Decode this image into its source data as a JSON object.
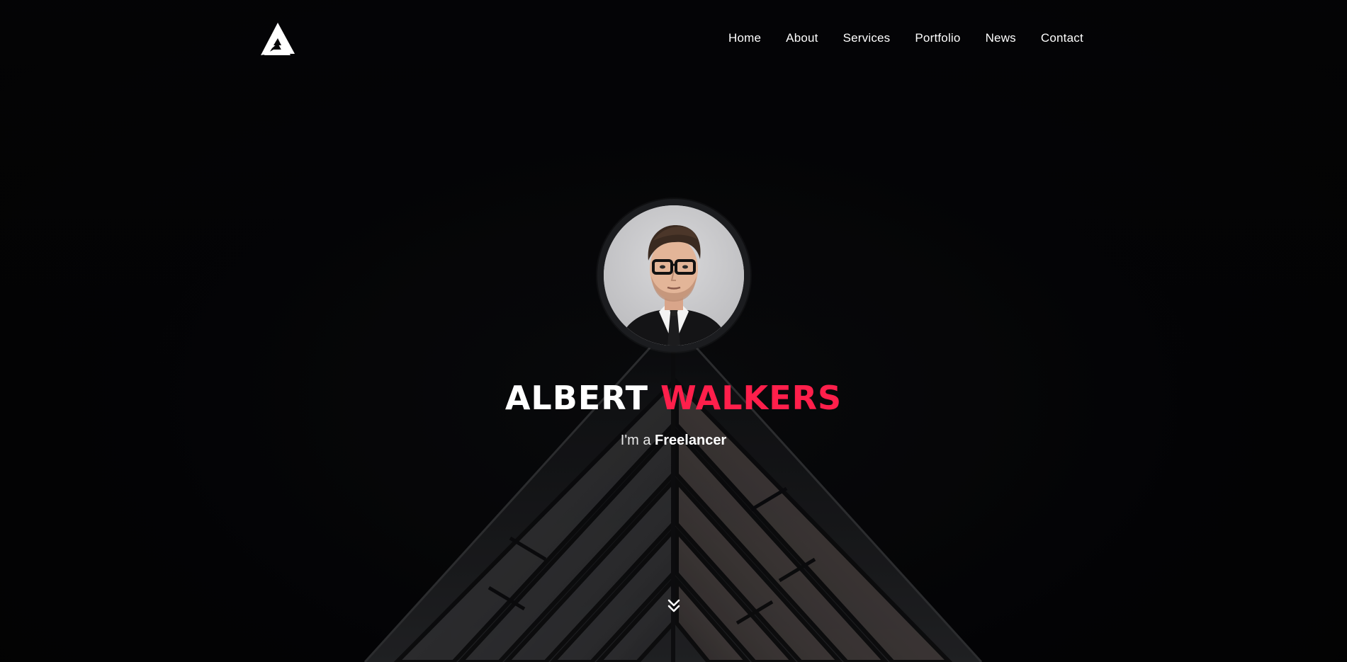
{
  "brand": {
    "logo_icon": "letter-a-triangle-logo"
  },
  "nav": {
    "items": [
      {
        "label": "Home"
      },
      {
        "label": "About"
      },
      {
        "label": "Services"
      },
      {
        "label": "Portfolio"
      },
      {
        "label": "News"
      },
      {
        "label": "Contact"
      }
    ]
  },
  "hero": {
    "first_name": "ALBERT",
    "last_name": "WALKERS",
    "subtitle_prefix": "I'm a",
    "subtitle_role": "Freelancer",
    "scroll_icon": "double-chevron-down-icon"
  },
  "colors": {
    "background": "#050507",
    "accent": "#ff1f4b",
    "text": "#ffffff"
  }
}
